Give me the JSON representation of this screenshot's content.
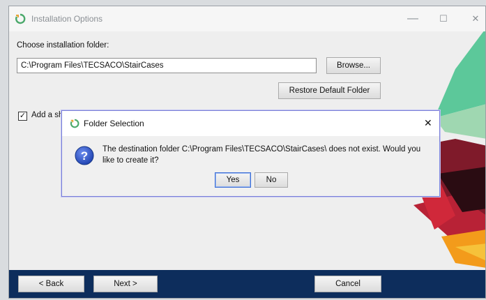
{
  "window": {
    "title": "Installation Options",
    "controls": {
      "minimize": "—",
      "maximize": "☐",
      "close": "✕"
    }
  },
  "folder": {
    "label": "Choose installation folder:",
    "value": "C:\\Program Files\\TECSACO\\StairCases",
    "browse_label": "Browse...",
    "restore_label": "Restore Default Folder"
  },
  "shortcut": {
    "checked": true,
    "label": "Add a sh"
  },
  "dialog": {
    "title": "Folder Selection",
    "close": "✕",
    "icon": "question-icon",
    "message_line1": "The destination folder C:\\Program Files\\TECSACO\\StairCases\\ does not exist. Would you",
    "message_line2": "like to create it?",
    "yes_label": "Yes",
    "no_label": "No"
  },
  "footer": {
    "back_label": "< Back",
    "next_label": "Next >",
    "cancel_label": "Cancel"
  },
  "colors": {
    "footer_bg": "#0d2d5c",
    "accent_green": "#5cc89a",
    "accent_red": "#b82236",
    "accent_orange": "#f39b1b",
    "dialog_border": "#7a7fd6"
  }
}
